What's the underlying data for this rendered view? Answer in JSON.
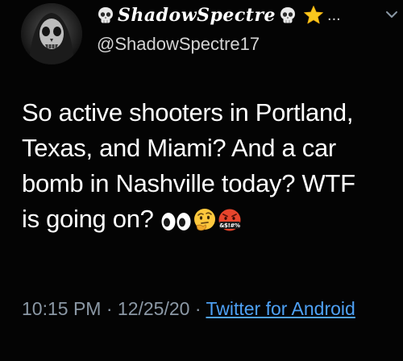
{
  "author": {
    "display_name": "ShadowSpectre",
    "handle": "@ShadowSpectre17",
    "name_prefix_icon": "skull-emoji",
    "name_suffix_icons": [
      "skull-emoji",
      "star-emoji"
    ],
    "overflow_indicator": "..."
  },
  "tweet": {
    "text_lines": [
      "So active shooters in Portland,",
      "Texas, and Miami? And a car",
      "bomb in Nashville today? WTF",
      "is going on? "
    ],
    "trailing_emojis": [
      "eyes-emoji",
      "thinking-face-emoji",
      "face-with-symbols-on-mouth-emoji"
    ],
    "cursing_emoji_text": "&$!#%"
  },
  "meta": {
    "time": "10:15 PM",
    "date": "12/25/20",
    "separator": " · ",
    "source": "Twitter for Android"
  },
  "colors": {
    "background": "#040404",
    "text": "#ffffff",
    "secondary_text": "#8b98a5",
    "link": "#4ea1f5"
  }
}
